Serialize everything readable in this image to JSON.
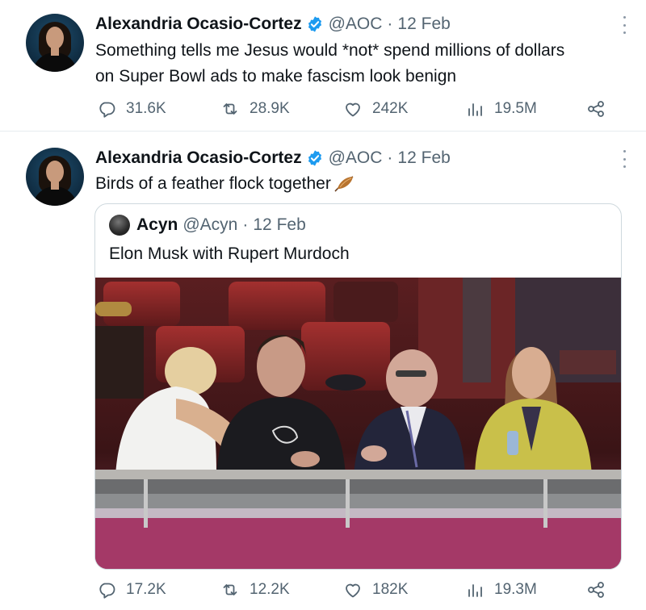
{
  "tweets": [
    {
      "author": {
        "name": "Alexandria Ocasio-Cortez",
        "handle": "@AOC",
        "separator": "·",
        "date": "12 Feb",
        "verified": true
      },
      "lines": [
        "Something tells me Jesus would *not* spend millions of dollars",
        "on Super Bowl ads to make fascism look benign"
      ],
      "metrics": {
        "replies": "31.6K",
        "retweets": "28.9K",
        "likes": "242K",
        "views": "19.5M"
      }
    },
    {
      "author": {
        "name": "Alexandria Ocasio-Cortez",
        "handle": "@AOC",
        "separator": "·",
        "date": "12 Feb",
        "verified": true
      },
      "text": "Birds of a feather flock together",
      "emoji": "feather-icon",
      "quote": {
        "author": {
          "name": "Acyn",
          "handle": "@Acyn",
          "separator": "·",
          "date": "12 Feb"
        },
        "text": "Elon Musk with Rupert Murdoch"
      },
      "metrics": {
        "replies": "17.2K",
        "retweets": "12.2K",
        "likes": "182K",
        "views": "19.3M"
      }
    }
  ],
  "icons": {
    "reply": "reply-icon",
    "retweet": "retweet-icon",
    "like": "heart-icon",
    "views": "views-icon",
    "share": "share-icon",
    "more": "more-icon",
    "verified": "verified-badge-icon"
  },
  "colors": {
    "verified": "#1d9bf0",
    "text": "#0f1419",
    "muted": "#536471",
    "border": "#cfd9de"
  }
}
